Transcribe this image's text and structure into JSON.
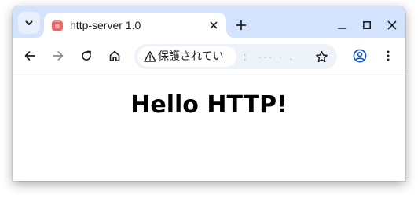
{
  "browser": {
    "tab": {
      "title": "http-server 1.0",
      "favicon": "http-server-favicon",
      "favicon_color": "#e8666a"
    },
    "tabstrip_color": "#d3e3fd",
    "toolbar": {
      "back": "arrow-left-icon",
      "forward": "arrow-right-icon",
      "reload": "reload-icon",
      "home": "home-icon"
    },
    "omnibox": {
      "security_label": "保護されてい",
      "security_icon": "warning-triangle-icon",
      "url_text": "：  ‐‐‐  ·  ．"
    },
    "window_controls": [
      "minimize-icon",
      "maximize-icon",
      "close-icon"
    ]
  },
  "page": {
    "heading": "Hello HTTP!"
  }
}
